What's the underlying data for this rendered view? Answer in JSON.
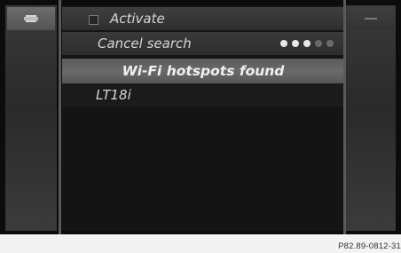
{
  "menu": {
    "activate_label": "Activate",
    "cancel_search_label": "Cancel search",
    "header_label": "Wi-Fi hotspots found",
    "networks": [
      "LT18i"
    ],
    "progress_dots_total": 5,
    "progress_dots_active": 3
  },
  "left_panel": {
    "icon": "back-icon"
  },
  "right_panel": {
    "icon": "menu-icon"
  },
  "caption": "P82.89-0812-31",
  "colors": {
    "background": "#0c0c0c",
    "highlight": "#6a6a6a",
    "text": "#d6d6d6"
  }
}
